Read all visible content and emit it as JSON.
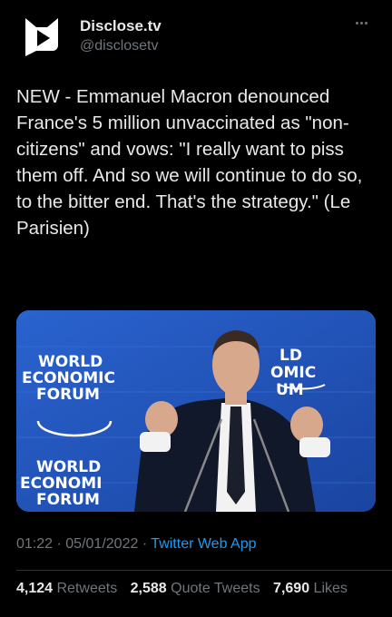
{
  "author": {
    "display_name": "Disclose.tv",
    "username": "@disclosetv",
    "avatar_icon": "speech-bubble-play-logo"
  },
  "tweet": {
    "text": "NEW - Emmanuel Macron denounced France's 5 million unvaccinated as \"non-citizens\" and vows: \"I really want to piss them off. And so we will continue to do so, to the bitter end. That's the strategy.\" (Le Parisien)"
  },
  "media": {
    "logo_top": [
      "WORLD",
      "ECONOMIC",
      "FORUM"
    ],
    "logo_bottom": [
      "WORLD",
      "ECONOMI",
      "FORUM"
    ],
    "logo_right": [
      "LD",
      "OMIC",
      "UM"
    ]
  },
  "meta": {
    "time": "01:22",
    "date": "05/01/2022",
    "separator": "·",
    "source": "Twitter Web App"
  },
  "stats": {
    "retweets_count": "4,124",
    "retweets_label": "Retweets",
    "quotes_count": "2,588",
    "quotes_label": "Quote Tweets",
    "likes_count": "7,690",
    "likes_label": "Likes"
  },
  "colors": {
    "background": "#000000",
    "text": "#e7e9ea",
    "secondary": "#71767b",
    "link": "#1d9bf0",
    "media_blue": "#1f4fb3"
  }
}
